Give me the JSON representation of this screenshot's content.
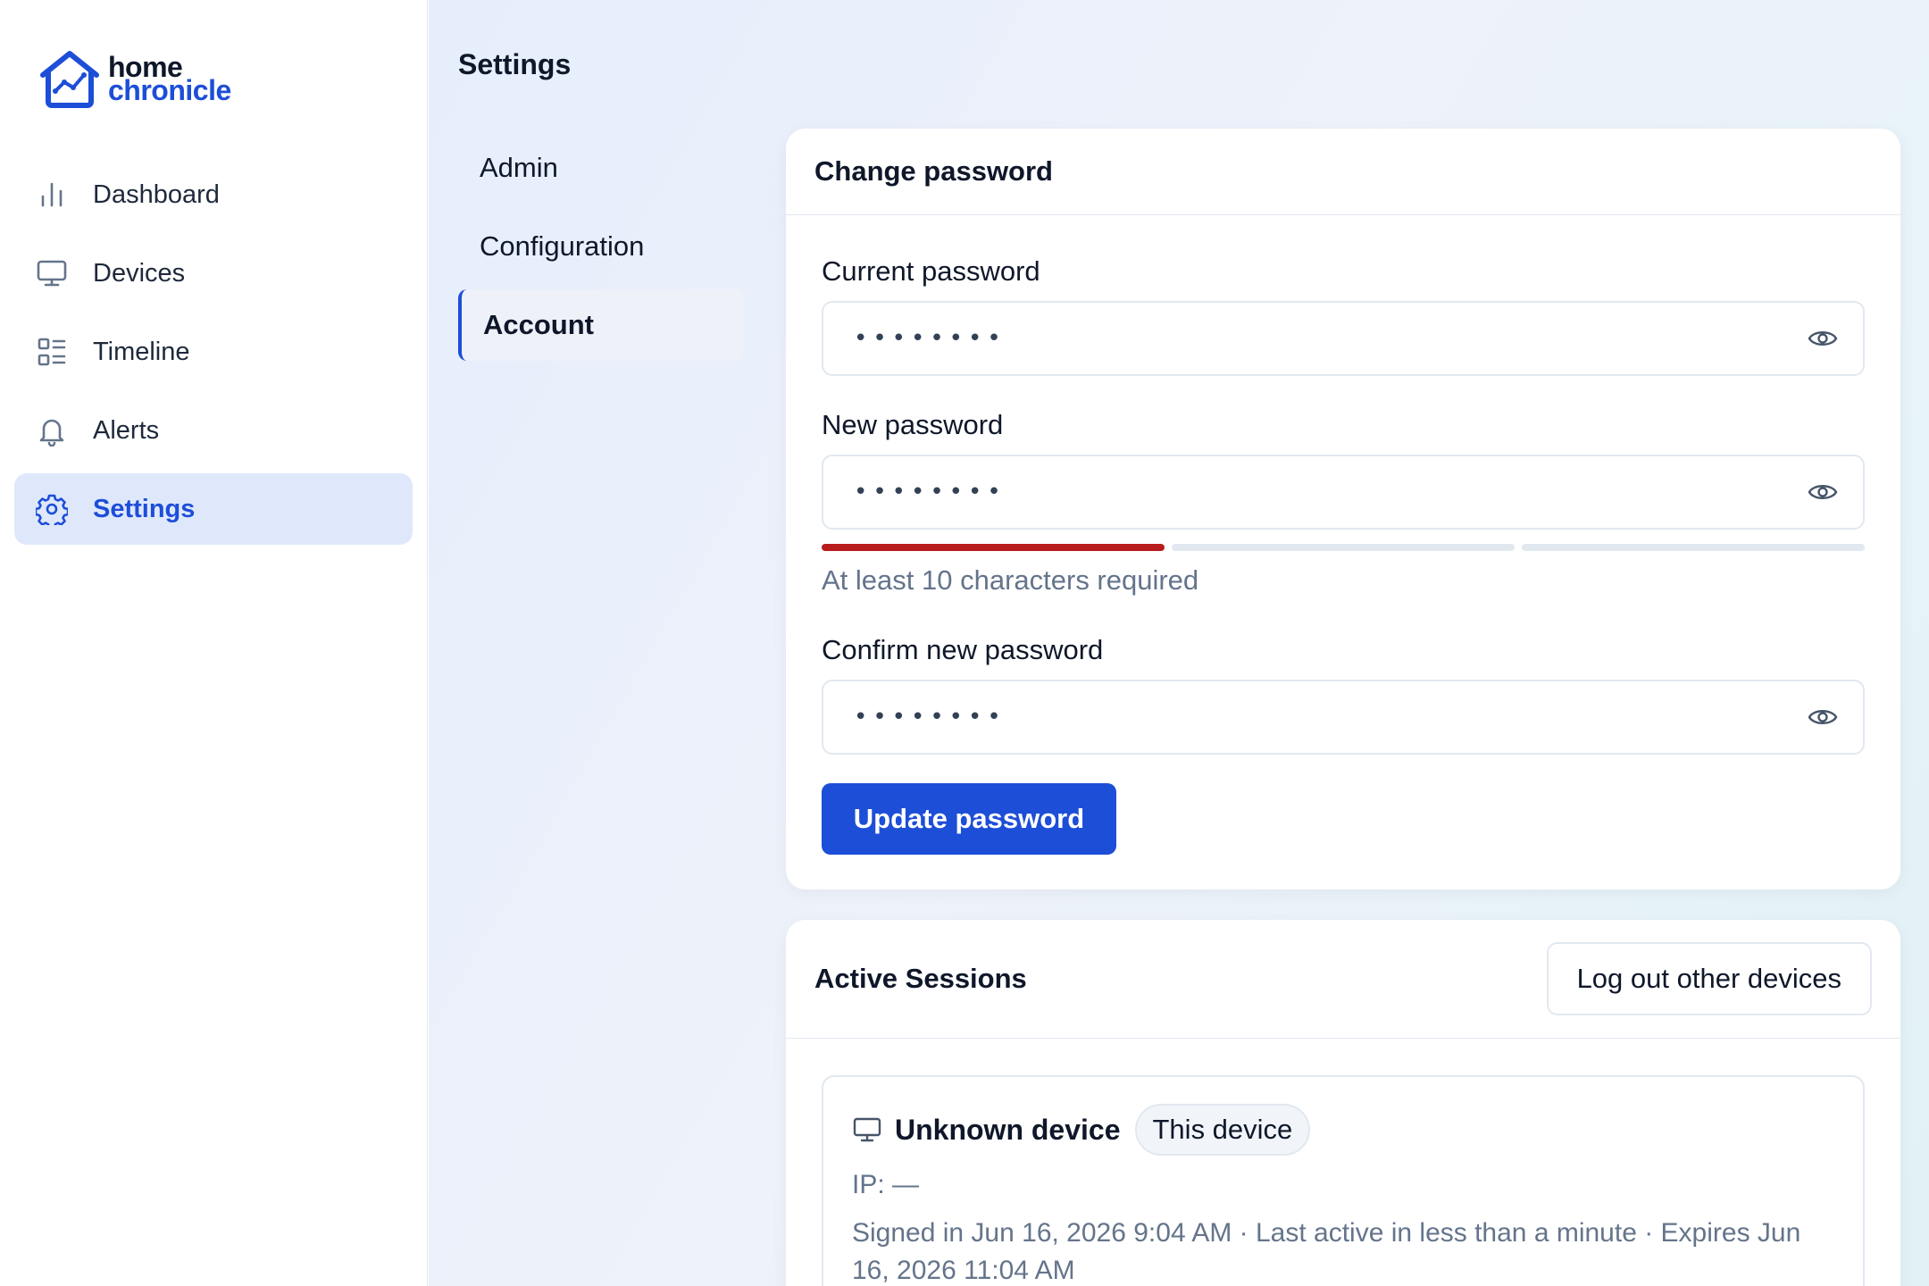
{
  "brand": {
    "line1": "home",
    "line2": "chronicle",
    "primary_color": "#1d4ed8"
  },
  "sidebar": {
    "items": [
      {
        "label": "Dashboard",
        "icon": "bar-chart-icon"
      },
      {
        "label": "Devices",
        "icon": "monitor-icon"
      },
      {
        "label": "Timeline",
        "icon": "timeline-list-icon"
      },
      {
        "label": "Alerts",
        "icon": "bell-icon"
      },
      {
        "label": "Settings",
        "icon": "gear-icon",
        "active": true
      }
    ]
  },
  "settings": {
    "title": "Settings",
    "tabs": [
      {
        "label": "Admin"
      },
      {
        "label": "Configuration"
      },
      {
        "label": "Account",
        "active": true
      }
    ]
  },
  "change_password": {
    "title": "Change password",
    "current": {
      "label": "Current password",
      "value": "••••••••"
    },
    "new": {
      "label": "New password",
      "value": "••••••••"
    },
    "strength_segments_filled": 1,
    "strength_segments_total": 3,
    "strength_color": "#b91c1c",
    "hint": "At least 10 characters required",
    "confirm": {
      "label": "Confirm new password",
      "value": "••••••••"
    },
    "submit_label": "Update password"
  },
  "sessions": {
    "title": "Active Sessions",
    "logout_label": "Log out other devices",
    "items": [
      {
        "device": "Unknown device",
        "badge": "This device",
        "ip": "IP: —",
        "meta": "Signed in Jun 16, 2026 9:04 AM · Last active in less than a minute · Expires Jun 16, 2026 11:04 AM"
      }
    ]
  }
}
